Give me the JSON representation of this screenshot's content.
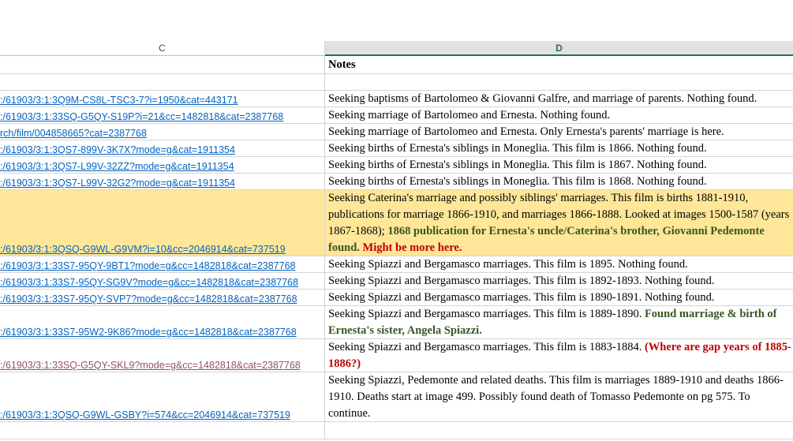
{
  "columns": {
    "c": "C",
    "d": "D"
  },
  "header_row": {
    "notes": "Notes"
  },
  "rows": [
    {
      "link": ":/61903/3:1:3Q9M-CS8L-TSC3-7?i=1950&cat=443171",
      "note": "Seeking baptisms of Bartolomeo & Giovanni Galfre, and marriage of parents. Nothing found."
    },
    {
      "link": ":/61903/3:1:33SQ-G5QY-S19P?i=21&cc=1482818&cat=2387768",
      "note": "Seeking marriage of Bartolomeo and Ernesta. Nothing found."
    },
    {
      "link": "rch/film/004858665?cat=2387768",
      "note": "Seeking marriage of Bartolomeo and Ernesta. Only Ernesta's parents' marriage is here."
    },
    {
      "link": ":/61903/3:1:3QS7-899V-3K7X?mode=g&cat=1911354",
      "note": "Seeking births of Ernesta's siblings in Moneglia. This film is 1866. Nothing found."
    },
    {
      "link": ":/61903/3:1:3QS7-L99V-32ZZ?mode=g&cat=1911354",
      "note": "Seeking births of Ernesta's siblings in Moneglia. This film is 1867. Nothing found."
    },
    {
      "link": ":/61903/3:1:3QS7-L99V-32G2?mode=g&cat=1911354",
      "note": "Seeking births of Ernesta's siblings in Moneglia. This film is 1868. Nothing found."
    },
    {
      "link": ":/61903/3:1:3QSQ-G9WL-G9VM?i=10&cc=2046914&cat=737519",
      "note": "Seeking Caterina's marriage and possibly siblings' marriages. This film is births 1881-1910, publications for marriage 1866-1910, and marriages 1866-1888. Looked at images 1500-1587 (years 1867-1868);",
      "green": " 1868 publication for Ernesta's uncle/Caterina's brother, Giovanni Pedemonte found.",
      "red": " Might be more here."
    },
    {
      "link": ":/61903/3:1:33S7-95QY-9BT1?mode=g&cc=1482818&cat=2387768",
      "note": "Seeking Spiazzi and Bergamasco marriages. This film is 1895. Nothing found."
    },
    {
      "link": ":/61903/3:1:33S7-95QY-SG9V?mode=g&cc=1482818&cat=2387768",
      "note": "Seeking Spiazzi and Bergamasco marriages. This film is 1892-1893. Nothing found."
    },
    {
      "link": ":/61903/3:1:33S7-95QY-SVP7?mode=g&cc=1482818&cat=2387768",
      "note": "Seeking Spiazzi and Bergamasco marriages. This film is 1890-1891. Nothing found."
    },
    {
      "link": ":/61903/3:1:33S7-95W2-9K86?mode=g&cc=1482818&cat=2387768",
      "note": "Seeking Spiazzi and Bergamasco marriages. This film is 1889-1890.",
      "green": " Found marriage & birth of Ernesta's sister, Angela Spiazzi."
    },
    {
      "link": ":/61903/3:1:33SQ-G5QY-SKL9?mode=g&cc=1482818&cat=2387768",
      "note": "Seeking Spiazzi and Bergamasco marriages. This film is 1883-1884.",
      "red": " (Where are gap years of 1885-1886?)"
    },
    {
      "link": ":/61903/3:1:3QSQ-G9WL-GSBY?i=574&cc=2046914&cat=737519",
      "note": "Seeking Spiazzi, Pedemonte and related deaths. This film is marriages 1889-1910 and deaths 1866-1910. Deaths start at image 499. Possibly found death of Tomasso Pedemonte on pg 575. To continue."
    }
  ],
  "colors": {
    "link": "#0563c1",
    "visited_link": "#954f72",
    "highlight": "#ffe699",
    "green_text": "#375623",
    "red_text": "#c00000",
    "selected_header": "#217346"
  }
}
